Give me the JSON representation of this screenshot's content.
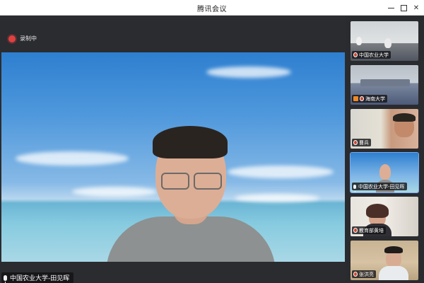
{
  "window": {
    "title": "腾讯会议"
  },
  "recording": {
    "label": "录制中",
    "color": "#e04040"
  },
  "main": {
    "speaker_label": "中国农业大学-田见晖",
    "menu_icon": "list-icon"
  },
  "sidebar": {
    "participants": [
      {
        "name": "中国农业大学",
        "icon": "mic-off-icon",
        "active": false
      },
      {
        "name": "海南大学",
        "icon": "mic-off-icon",
        "active": false
      },
      {
        "name": "曹兵",
        "icon": "mic-off-icon",
        "active": false
      },
      {
        "name": "中国农业大学-田见晖",
        "icon": "mic-icon",
        "active": true
      },
      {
        "name": "教育部黄培",
        "icon": "mic-off-icon",
        "active": false
      },
      {
        "name": "张洪亮",
        "icon": "mic-off-icon",
        "active": false
      }
    ]
  }
}
